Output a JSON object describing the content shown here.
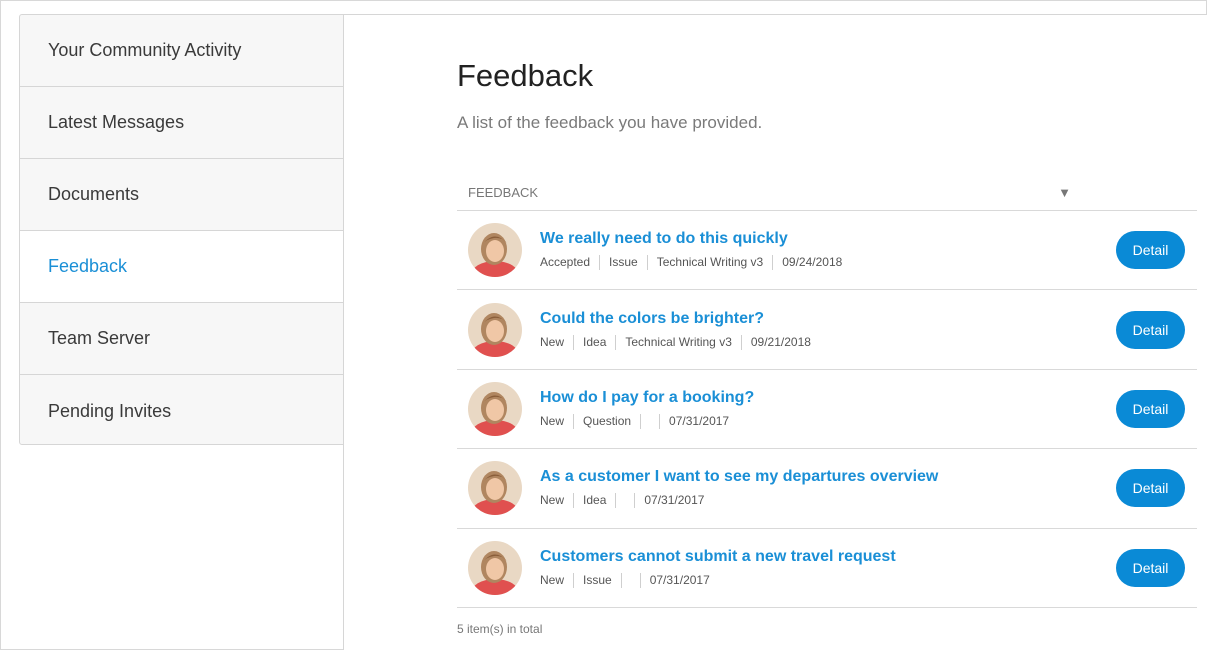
{
  "sidebar": {
    "items": [
      {
        "label": "Your Community Activity",
        "active": false
      },
      {
        "label": "Latest Messages",
        "active": false
      },
      {
        "label": "Documents",
        "active": false
      },
      {
        "label": "Feedback",
        "active": true
      },
      {
        "label": "Team Server",
        "active": false
      },
      {
        "label": "Pending Invites",
        "active": false
      }
    ]
  },
  "main": {
    "title": "Feedback",
    "subtitle": "A list of the feedback you have provided.",
    "list": {
      "header_label": "FEEDBACK",
      "sort_icon": "▼",
      "detail_label": "Detail",
      "rows": [
        {
          "title": "We really need to do this quickly",
          "status": "Accepted",
          "type": "Issue",
          "category": "Technical Writing v3",
          "date": "09/24/2018"
        },
        {
          "title": "Could the colors be brighter?",
          "status": "New",
          "type": "Idea",
          "category": "Technical Writing v3",
          "date": "09/21/2018"
        },
        {
          "title": "How do I pay for a booking?",
          "status": "New",
          "type": "Question",
          "category": "",
          "date": "07/31/2017"
        },
        {
          "title": "As a customer I want to see my departures overview",
          "status": "New",
          "type": "Idea",
          "category": "",
          "date": "07/31/2017"
        },
        {
          "title": "Customers cannot submit a new travel request",
          "status": "New",
          "type": "Issue",
          "category": "",
          "date": "07/31/2017"
        }
      ],
      "total_text": "5 item(s) in total"
    }
  },
  "colors": {
    "accent": "#1a8fd6",
    "button": "#0a8ad6",
    "sidebar_bg": "#f7f7f7"
  }
}
